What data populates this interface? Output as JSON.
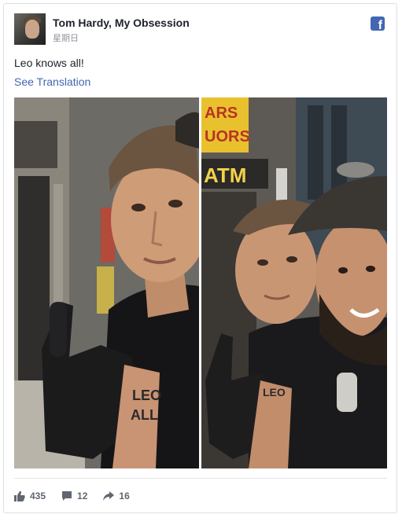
{
  "post": {
    "page_name": "Tom Hardy, My Obsession",
    "timestamp": "星期日",
    "text": "Leo knows all!",
    "see_translation": "See Translation",
    "brand_icon": "facebook-icon",
    "brand_color": "#4267b2",
    "photos": [
      {
        "description_icon": "photo-selfie-left"
      },
      {
        "description_icon": "photo-selfie-right"
      }
    ]
  },
  "footer": {
    "likes": "435",
    "comments": "12",
    "shares": "16"
  }
}
